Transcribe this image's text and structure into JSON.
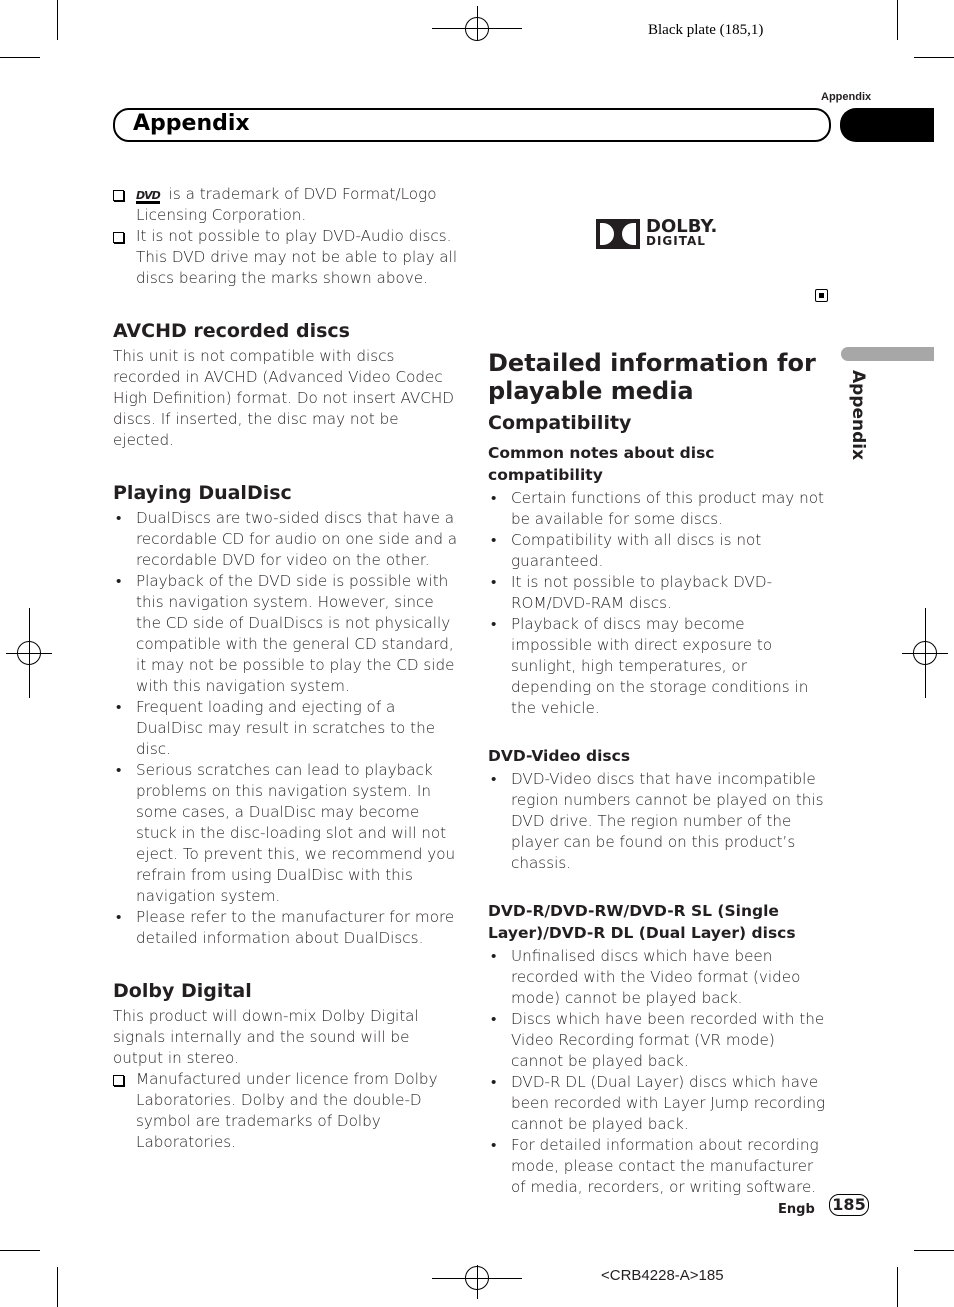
{
  "print_marks": {
    "plate": "Black plate (185,1)",
    "code": "<CRB4228-A>185"
  },
  "header": {
    "running_head": "Appendix",
    "title": "Appendix",
    "side_tab": "Appendix"
  },
  "left_column": {
    "notes": [
      {
        "logo": "DVD",
        "text": "is a trademark of DVD Format/Logo Licensing Corporation."
      },
      {
        "text": "It is not possible to play DVD-Audio discs. This DVD drive may not be able to play all discs bearing the marks shown above."
      }
    ],
    "avchd": {
      "heading": "AVCHD recorded discs",
      "body": "This unit is not compatible with discs recorded in AVCHD (Advanced Video Codec High Definition) format. Do not insert AVCHD discs. If inserted, the disc may not be ejected."
    },
    "dualdisc": {
      "heading": "Playing DualDisc",
      "bullets": [
        "DualDiscs are two-sided discs that have a recordable CD for audio on one side and a recordable DVD for video on the other.",
        "Playback of the DVD side is possible with this navigation system. However, since the CD side of DualDiscs is not physically compatible with the general CD standard, it may not be possible to play the CD side with this navigation system.",
        "Frequent loading and ejecting of a DualDisc may result in scratches to the disc.",
        "Serious scratches can lead to playback problems on this navigation system. In some cases, a DualDisc may become stuck in the disc-loading slot and will not eject. To prevent this, we recommend you refrain from using DualDisc with this navigation system.",
        "Please refer to the manufacturer for more detailed information about DualDiscs."
      ]
    },
    "dolby": {
      "heading": "Dolby Digital",
      "body": "This product will down-mix Dolby Digital signals internally and the sound will be output in stereo.",
      "note": "Manufactured under licence from Dolby Laboratories. Dolby and the double-D symbol are trademarks of Dolby Laboratories."
    }
  },
  "right_column": {
    "dolby_logo": {
      "line1": "DOLBY.",
      "line2": "DIGITAL"
    },
    "main_heading": "Detailed information for playable media",
    "compat_heading": "Compatibility",
    "common": {
      "heading": "Common notes about disc compatibility",
      "bullets": [
        "Certain functions of this product may not be available for some discs.",
        "Compatibility with all discs is not guaranteed.",
        "It is not possible to playback DVD-ROM/DVD-RAM discs.",
        "Playback of discs may become impossible with direct exposure to sunlight, high temperatures, or depending on the storage conditions in the vehicle."
      ]
    },
    "dvd_video": {
      "heading": "DVD-Video discs",
      "bullets": [
        "DVD-Video discs that have incompatible region numbers cannot be played on this DVD drive. The region number of the player can be found on this product’s chassis."
      ]
    },
    "dvd_r": {
      "heading": "DVD-R/DVD-RW/DVD-R SL (Single Layer)/DVD-R DL (Dual Layer) discs",
      "bullets": [
        "Unfinalised discs which have been recorded with the Video format (video mode) cannot be played back.",
        "Discs which have been recorded with the Video Recording format (VR mode) cannot be played back.",
        "DVD-R DL (Dual Layer) discs which have been recorded with Layer Jump recording cannot be played back.",
        "For detailed information about recording mode, please contact the manufacturer of media, recorders, or writing software."
      ]
    }
  },
  "footer": {
    "language": "Engb",
    "page_number": "185"
  }
}
